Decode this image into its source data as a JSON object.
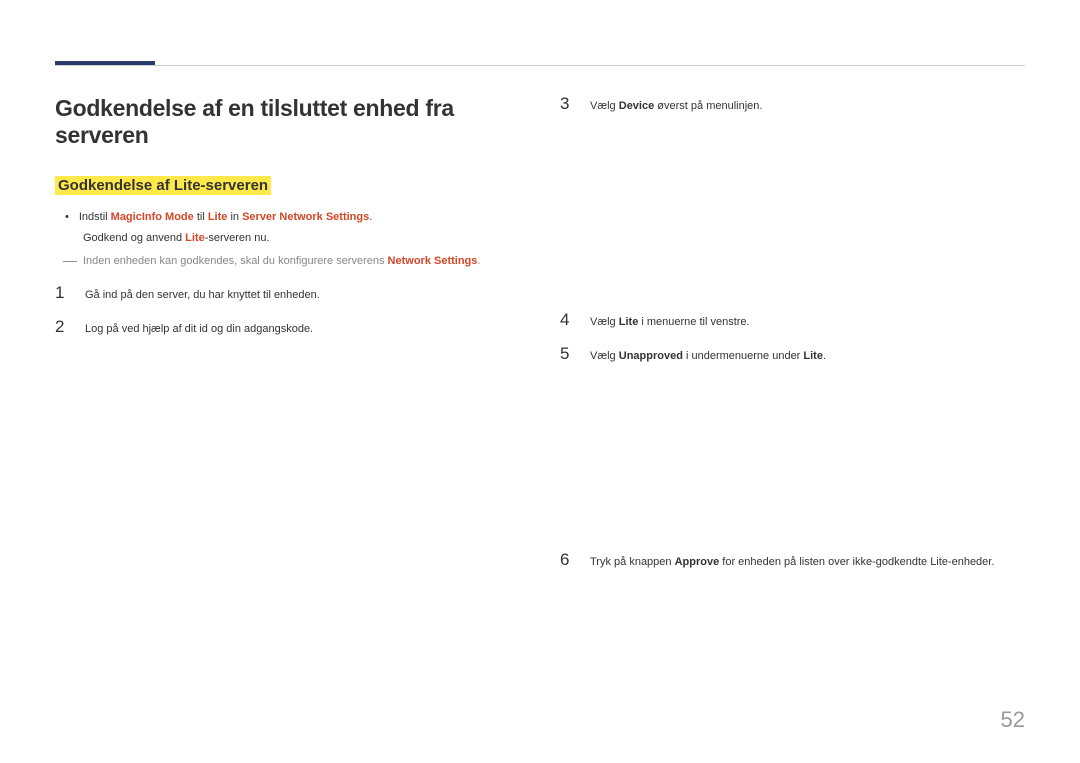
{
  "heading": "Godkendelse af en tilsluttet enhed fra serveren",
  "subheading": "Godkendelse af Lite-serveren",
  "bullet": {
    "pre": "Indstil ",
    "magic": "MagicInfo Mode",
    "mid1": " til ",
    "lite1": "Lite",
    "mid2": " in ",
    "sns": "Server Network Settings",
    "end": ".",
    "sub_pre": "Godkend og anvend ",
    "sub_lite": "Lite",
    "sub_end": "-serveren nu."
  },
  "note": {
    "pre": "Inden enheden kan godkendes, skal du konfigurere serverens ",
    "ns": "Network Settings",
    "end": "."
  },
  "steps_left": [
    {
      "num": "1",
      "text": "Gå ind på den server, du har knyttet til enheden."
    },
    {
      "num": "2",
      "text": "Log på ved hjælp af dit id og din adgangskode."
    }
  ],
  "step3": {
    "num": "3",
    "pre": "Vælg ",
    "bold1": "Device",
    "post": " øverst på menulinjen."
  },
  "step4": {
    "num": "4",
    "pre": "Vælg ",
    "bold1": "Lite",
    "post": " i menuerne til venstre."
  },
  "step5": {
    "num": "5",
    "pre": "Vælg ",
    "bold1": "Unapproved",
    "mid": " i undermenuerne under ",
    "bold2": "Lite",
    "post": "."
  },
  "step6": {
    "num": "6",
    "pre": "Tryk på knappen ",
    "bold1": "Approve",
    "post": " for enheden på listen over ikke-godkendte Lite-enheder."
  },
  "page_number": "52"
}
